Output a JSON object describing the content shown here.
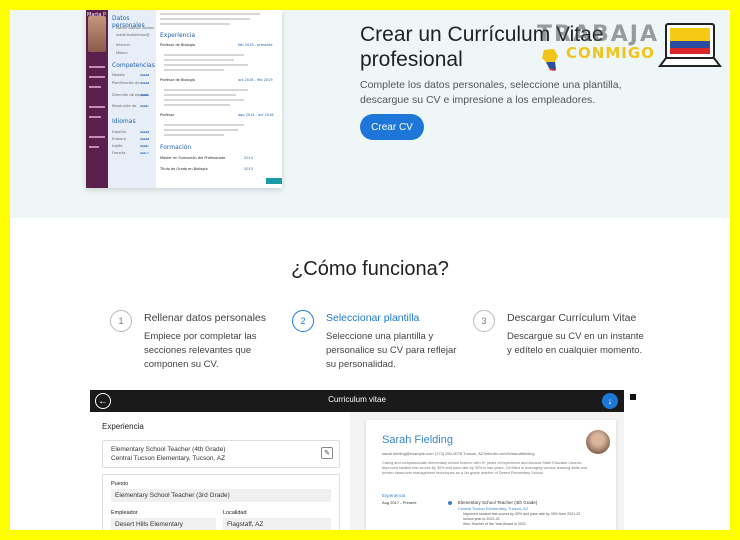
{
  "hero": {
    "title": "Crear un Currículum Vitae profesional",
    "subtitle": "Complete los datos personales, seleccione una plantilla, descargue su CV e impresione a los empleadores.",
    "cta": "Crear CV"
  },
  "logo": {
    "line1": "TRABAJA",
    "line2": "CONMIGO"
  },
  "cv_preview": {
    "name": "Marta P",
    "sections": [
      "Datos personales",
      "Competencias",
      "Idiomas",
      "Experiencia",
      "Formación"
    ],
    "personal": [
      "Martin Gómez Gomez",
      "martinbutterman@",
      "Internet",
      "Milano"
    ],
    "skills": [
      "Modelo",
      "Planificación de",
      "Dirección de equipos",
      "Resolución de"
    ],
    "languages": [
      "Español",
      "Euskera",
      "Inglés",
      "Francés"
    ],
    "jobs": [
      {
        "title": "Profesor de Biología",
        "date": "feb 2019 - presente"
      },
      {
        "title": "Profesor de Biología",
        "date": "oct 2016 - feb 2019"
      },
      {
        "title": "Profesor",
        "date": "ago 2014 - oct 2016"
      }
    ],
    "education": [
      {
        "title": "Máster en Formación del Profesorado",
        "date": "2014"
      },
      {
        "title": "Título de Grado en Biología",
        "date": "2013"
      }
    ]
  },
  "how": {
    "title": "¿Cómo funciona?",
    "steps": [
      {
        "num": "1",
        "title": "Rellenar datos personales",
        "desc": "Empiece por completar las secciones relevantes que componen su CV."
      },
      {
        "num": "2",
        "title": "Seleccionar plantilla",
        "desc": "Seleccione una plantilla y personalice su CV para reflejar su personalidad."
      },
      {
        "num": "3",
        "title": "Descargar Currículum Vitae",
        "desc": "Descargue su CV en un instante y edítelo en cualquier momento."
      }
    ]
  },
  "editor": {
    "bar_title": "Curriculum vitae",
    "section": "Experiencia",
    "card_title": "Elementary School Teacher (4th Grade)",
    "card_sub": "Central Tucson Elementary, Tucson, AZ",
    "puesto_label": "Puesto",
    "puesto_value": "Elementary School Teacher (3rd Grade)",
    "empleador_label": "Empleador",
    "empleador_value": "Desert Hills Elementary",
    "localidad_label": "Localidad",
    "localidad_value": "Flagstaff, AZ"
  },
  "resume": {
    "name": "Sarah Fielding",
    "contacts": "sarah.fielding@example.com   (173) 250-0078   Tucson, AZ   linkedin.com/in/sarahfielding",
    "bio": "Caring and compassionate elementary school teacher with 5+ years of experience and Arizona State Educator License. Improved student test scores by 30% and pass rate by 30% in two years. Certified in leveraging various learning skills and proven classroom management techniques as a 1st grade teacher of Desert Elementary School.",
    "exp_label": "Experiencia",
    "date": "Aug 2017 - Present",
    "job": "Elementary School Teacher (4th Grade)",
    "company": "Central Tucson Elementary, Tucson, AZ",
    "bullets": [
      "Improved student test scores by 30% and pass rate by 30% from 2021-22",
      "school year to 2022-23",
      "Won Teacher of the Year Award in 2021"
    ]
  }
}
